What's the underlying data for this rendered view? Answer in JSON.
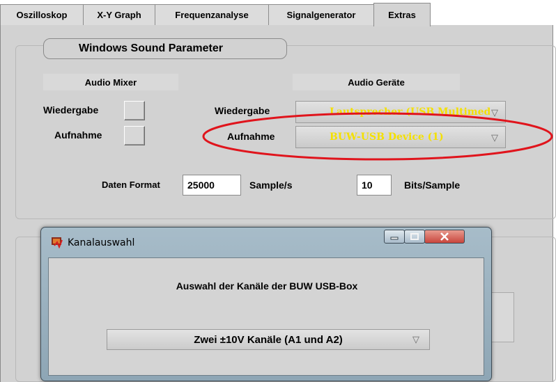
{
  "tabs": [
    {
      "label": "Oszilloskop"
    },
    {
      "label": "X-Y Graph"
    },
    {
      "label": "Frequenzanalyse"
    },
    {
      "label": "Signalgenerator"
    },
    {
      "label": "Extras"
    }
  ],
  "active_tab": "Extras",
  "sound": {
    "title": "Windows Sound Parameter",
    "audio_mixer_label": "Audio Mixer",
    "audio_devices_label": "Audio Geräte",
    "playback_label": "Wiedergabe",
    "record_label": "Aufnahme",
    "playback_device_label": "Wiedergabe",
    "playback_device_value": "Lautsprecher (USB Multimedia",
    "record_device_label": "Aufnahme",
    "record_device_value": "BUW-USB Device (1)",
    "data_format_label": "Daten Format",
    "sample_rate_value": "25000",
    "sample_rate_unit": "Sample/s",
    "bits_value": "10",
    "bits_unit": "Bits/Sample"
  },
  "dialog": {
    "title": "Kanalauswahl",
    "heading": "Auswahl der Kanäle der BUW USB-Box",
    "channel_value": "Zwei ±10V Kanäle (A1 und A2)"
  },
  "colors": {
    "panel_bg": "#d2d2d2",
    "dropdown_text": "#f4e000",
    "highlight_ellipse": "#e0141c",
    "close_button": "#c9463d"
  }
}
